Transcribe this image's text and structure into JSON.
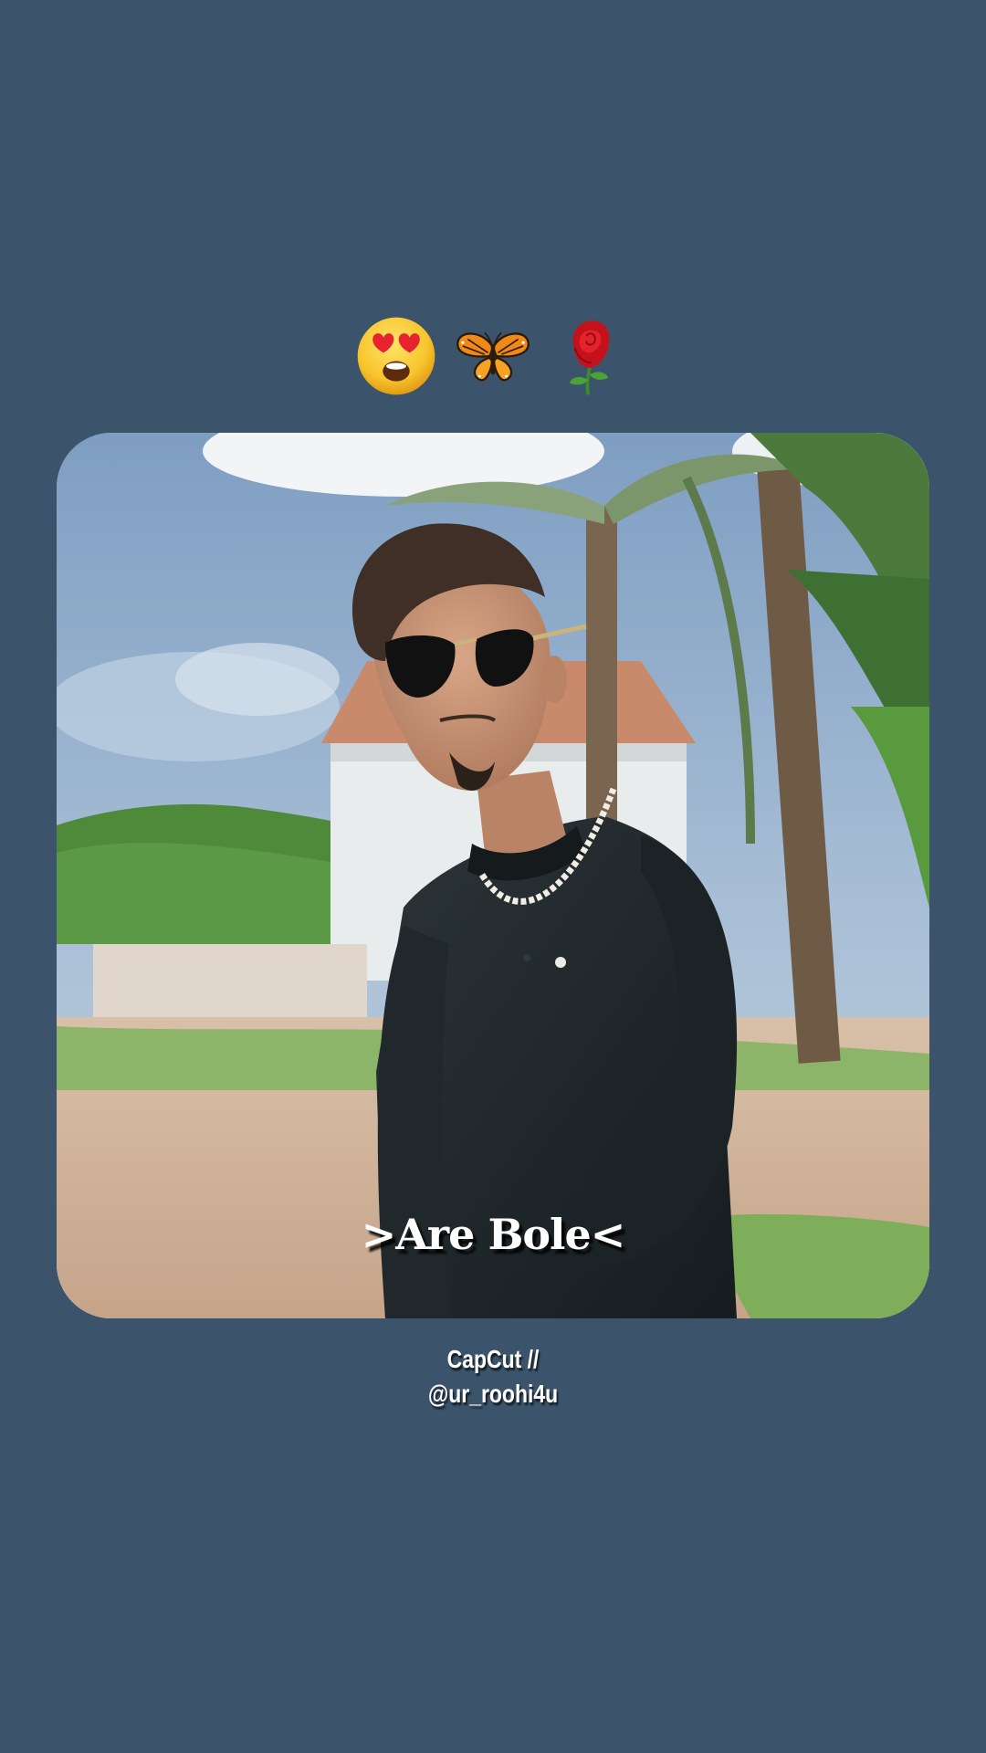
{
  "background_color": "#3b546c",
  "emojis": [
    {
      "icon": "heart-eyes-face-emoji"
    },
    {
      "icon": "butterfly-emoji"
    },
    {
      "icon": "rose-emoji"
    }
  ],
  "photo": {
    "subject": "photo"
  },
  "caption": {
    "text": ">Are Bole<"
  },
  "credit": {
    "line1": "CapCut //",
    "line2": "@ur_roohi4u"
  }
}
